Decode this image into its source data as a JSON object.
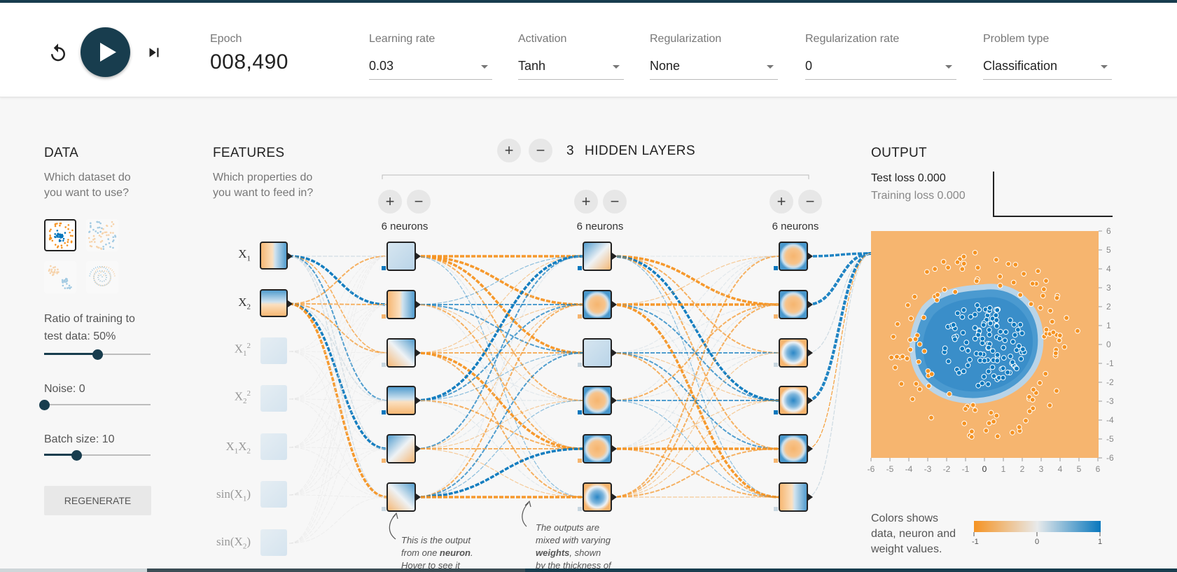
{
  "header": {
    "epoch_label": "Epoch",
    "epoch_value": "008,490",
    "learning_rate": {
      "label": "Learning rate",
      "value": "0.03"
    },
    "activation": {
      "label": "Activation",
      "value": "Tanh"
    },
    "regularization": {
      "label": "Regularization",
      "value": "None"
    },
    "regularization_rate": {
      "label": "Regularization rate",
      "value": "0"
    },
    "problem_type": {
      "label": "Problem type",
      "value": "Classification"
    }
  },
  "data": {
    "title": "DATA",
    "subtitle_line1": "Which dataset do",
    "subtitle_line2": "you want to use?",
    "ratio_label_line1": "Ratio of training to",
    "ratio_label_line2": "test data:  50%",
    "ratio_value": 0.5,
    "noise_label": "Noise:  0",
    "noise_value": 0,
    "batch_label": "Batch size:  10",
    "batch_value": 0.3,
    "regenerate": "REGENERATE",
    "datasets": [
      "circle-dataset",
      "xor-dataset",
      "gaussian-dataset",
      "spiral-dataset"
    ]
  },
  "features": {
    "title": "FEATURES",
    "subtitle_line1": "Which properties do",
    "subtitle_line2": "you want to feed in?"
  },
  "hidden": {
    "count": "3",
    "title": "HIDDEN LAYERS",
    "plus": "+",
    "minus": "−",
    "layers": [
      {
        "neurons_label": "6 neurons"
      },
      {
        "neurons_label": "6 neurons"
      },
      {
        "neurons_label": "6 neurons"
      }
    ],
    "note1_line1": "This is the output",
    "note1_line2_a": "from one ",
    "note1_line2_b": "neuron",
    "note1_line2_c": ".",
    "note1_line3": "Hover to see it",
    "note2_line1": "The outputs are",
    "note2_line2": "mixed with varying",
    "note2_line3_a": "weights",
    "note2_line3_b": ", shown",
    "note2_line4": "by the thickness of"
  },
  "output": {
    "title": "OUTPUT",
    "test_loss": "Test loss 0.000",
    "training_loss": "Training loss 0.000",
    "y_ticks": [
      "6",
      "5",
      "4",
      "3",
      "2",
      "1",
      "0",
      "-1",
      "-2",
      "-3",
      "-4",
      "-5",
      "-6"
    ],
    "x_ticks": [
      "-6",
      "-5",
      "-4",
      "-3",
      "-2",
      "-1",
      "0",
      "1",
      "2",
      "3",
      "4",
      "5",
      "6"
    ],
    "legend_line1": "Colors shows",
    "legend_line2": "data, neuron and",
    "legend_line3": "weight values.",
    "legend_min": "-1",
    "legend_mid": "0",
    "legend_max": "1"
  },
  "colors": {
    "orange": "#f59322",
    "blue": "#0877bd",
    "dark": "#183d4e",
    "bg_orange": "#f6b56f"
  }
}
